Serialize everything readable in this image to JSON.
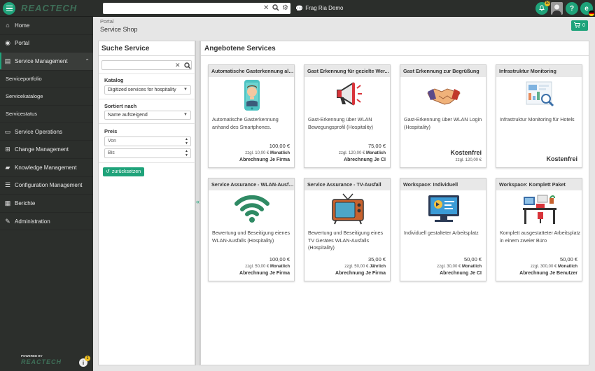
{
  "topbar": {
    "logo_text": "REACTECH",
    "search_placeholder": "",
    "ask_label": "Frag Ria Demo",
    "notification_count": "10",
    "icons": [
      "menu-icon",
      "clear-icon",
      "search-icon",
      "settings-icon",
      "chat-icon",
      "bell-icon",
      "help-icon",
      "user-avatar-icon",
      "language-icon"
    ]
  },
  "sidebar": {
    "items": [
      {
        "label": "Home",
        "icon": "home-icon"
      },
      {
        "label": "Portal",
        "icon": "globe-icon"
      },
      {
        "label": "Service Management",
        "icon": "clipboard-icon"
      },
      {
        "label": "Service Operations",
        "icon": "server-icon"
      },
      {
        "label": "Change Management",
        "icon": "sitemap-icon"
      },
      {
        "label": "Knowledge Management",
        "icon": "book-icon"
      },
      {
        "label": "Configuration Management",
        "icon": "database-icon"
      },
      {
        "label": "Berichte",
        "icon": "chart-icon"
      },
      {
        "label": "Administration",
        "icon": "wrench-icon"
      }
    ],
    "subitems": [
      {
        "label": "Serviceportfolio"
      },
      {
        "label": "Servicekataloge"
      },
      {
        "label": "Servicestatus"
      }
    ],
    "powered_by": "POWERED BY",
    "powered_logo": "REACTECH",
    "info_badge": "1"
  },
  "header": {
    "breadcrumb": "Portal",
    "title": "Service Shop",
    "cart_count": "0"
  },
  "filter": {
    "title": "Suche Service",
    "search_value": "",
    "katalog_label": "Katalog",
    "katalog_value": "Digitized services for hospitality",
    "sort_label": "Sortiert nach",
    "sort_value": "Name aufsteigend",
    "price_label": "Preis",
    "from_placeholder": "Von",
    "to_placeholder": "Bis",
    "reset_label": "zurücksetzen"
  },
  "services": {
    "title": "Angebotene Services",
    "cards": [
      {
        "title": "Automatische Gasterkennung als...",
        "desc": "Automatische Gasterkennung anhand des Smartphones.",
        "price": "100,00 €",
        "fee": "zzgl.  10,00 €",
        "period": "Monatlich",
        "billing": "Abrechnung Je Firma",
        "icon": "smartphone-face-icon"
      },
      {
        "title": "Gast Erkennung für gezielte Wer...",
        "desc": "Gast-Erkennung über WLAN Bewegungsprofil (Hospitality)",
        "price": "75,00 €",
        "fee": "zzgl.  120,00 €",
        "period": "Monatlich",
        "billing": "Abrechnung Je CI",
        "icon": "megaphone-icon"
      },
      {
        "title": "Gast Erkennung zur Begrüßung",
        "desc": "Gast-Erkennung über WLAN Login (Hospitality)",
        "price": "Kostenfrei",
        "fee": "zzgl.  120,00 €",
        "period": "",
        "billing": "",
        "icon": "handshake-icon"
      },
      {
        "title": "Infrastruktur Monitoring",
        "desc": "Infrastruktur Monitoring für Hotels",
        "price": "Kostenfrei",
        "fee": "",
        "period": "",
        "billing": "",
        "icon": "monitoring-dashboard-icon"
      },
      {
        "title": "Service Assurance - WLAN-Ausfall",
        "desc": "Bewertung und Beseitigung eienes WLAN-Ausfalls (Hospitality)",
        "price": "100,00 €",
        "fee": "zzgl.  50,00 €",
        "period": "Monatlich",
        "billing": "Abrechnung Je Firma",
        "icon": "wifi-icon"
      },
      {
        "title": "Service Assurance - TV-Ausfall",
        "desc": "Bewertung und Beseitigung eines TV Gerätes WLAN-Ausfalls (Hospitality)",
        "price": "35,00 €",
        "fee": "zzgl.  50,00 €",
        "period": "Jährlich",
        "billing": "Abrechnung Je Firma",
        "icon": "tv-icon"
      },
      {
        "title": "Workspace: Individuell",
        "desc": "Individuell gestalteter Arbeitsplatz",
        "price": "50,00 €",
        "fee": "zzgl.  30,00 €",
        "period": "Monatlich",
        "billing": "Abrechnung Je CI",
        "icon": "video-workspace-icon"
      },
      {
        "title": "Workspace: Komplett Paket",
        "desc": "Komplett ausgestatteter Arbeitsplatz in einem zweier Büro",
        "price": "50,00 €",
        "fee": "zzgl.  300,00 €",
        "period": "Monatlich",
        "billing": "Abrechnung Je Benutzer",
        "icon": "desk-workspace-icon"
      }
    ]
  },
  "colors": {
    "accent": "#1fa37a",
    "sidebar": "#2c2f2c",
    "topbar": "#2b2e2b"
  }
}
